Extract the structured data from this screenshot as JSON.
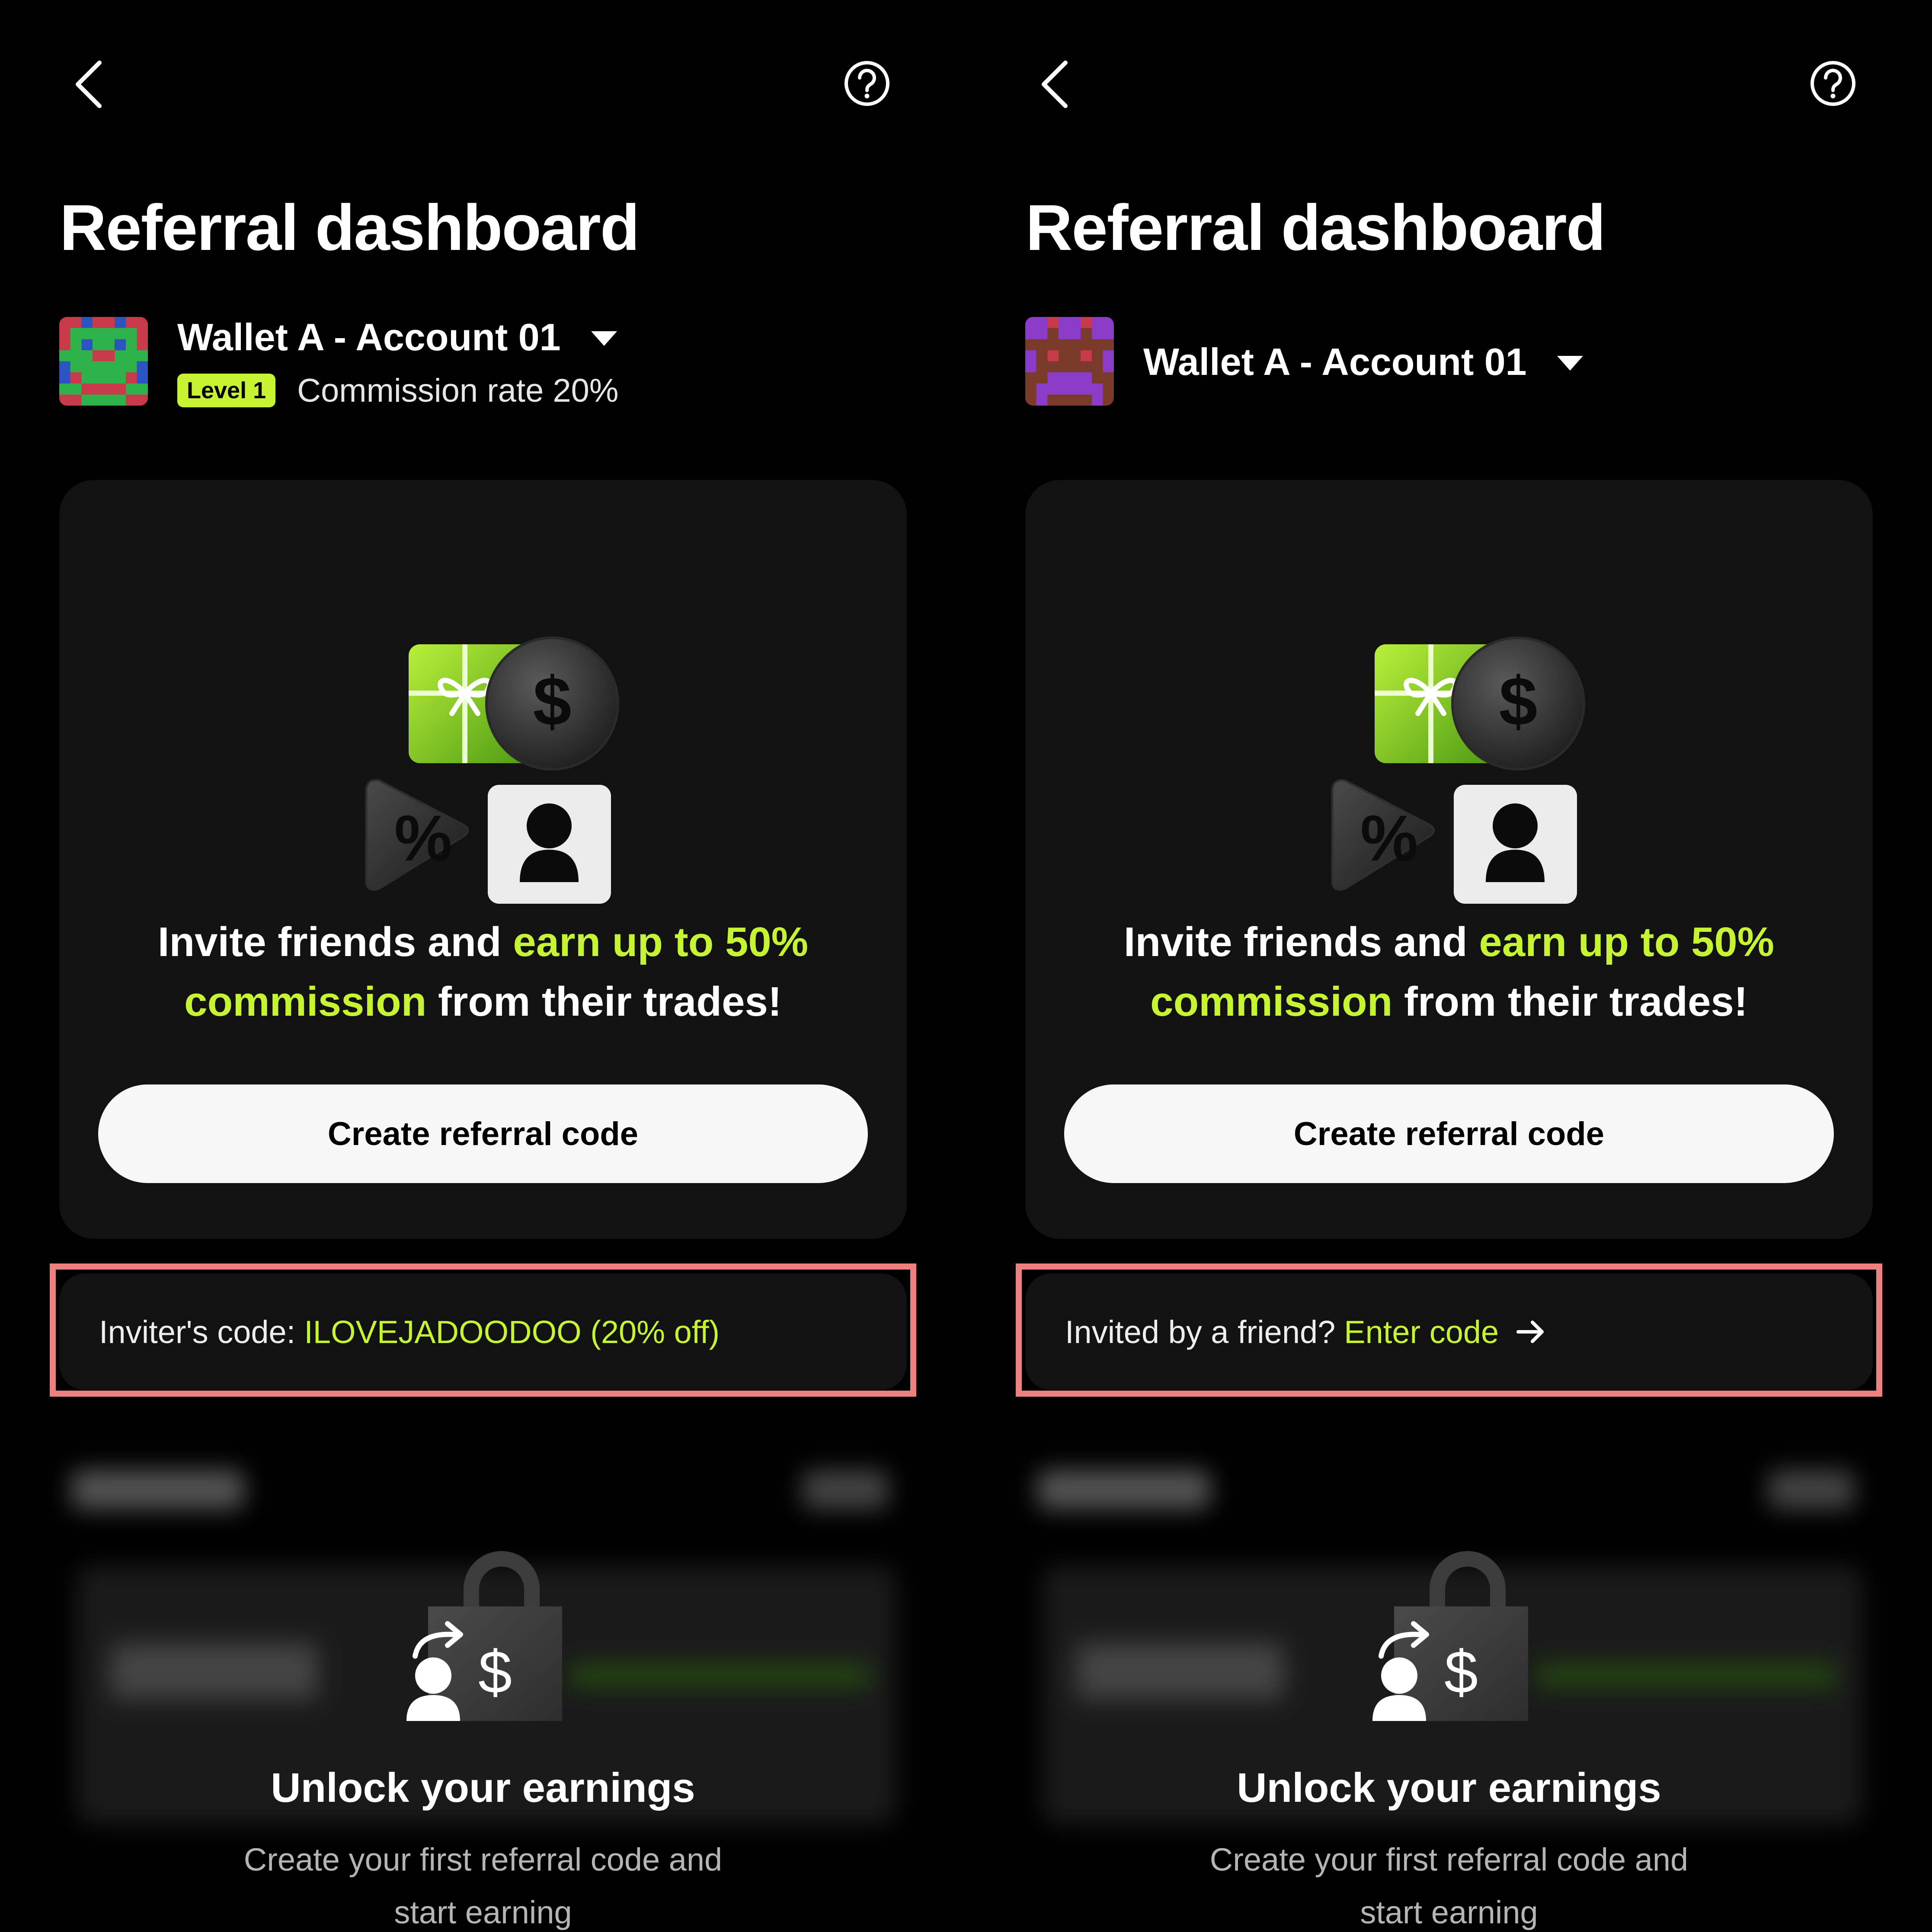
{
  "colors": {
    "accent": "#c6f432",
    "background": "#000000",
    "card": "#121212",
    "highlight_border": "#f08080",
    "button_bg": "#f7f7f7"
  },
  "screens": [
    {
      "header": {
        "back_icon": "chevron-left-icon",
        "help_icon": "question-circle-icon"
      },
      "title": "Referral dashboard",
      "account": {
        "name": "Wallet A - Account 01",
        "level": "Level 1",
        "commission": "Commission rate 20%"
      },
      "promo": {
        "part1": "Invite friends and ",
        "highlight": "earn up to 50% commission",
        "part2": " from their trades!"
      },
      "cta": "Create referral code",
      "code_bar": {
        "label": "Inviter's code:",
        "value": "ILOVEJADOODOO (20% off)"
      },
      "unlock": {
        "title": "Unlock your earnings",
        "line1": "Create your first referral code and",
        "line2": "start earning"
      }
    },
    {
      "header": {
        "back_icon": "chevron-left-icon",
        "help_icon": "question-circle-icon"
      },
      "title": "Referral dashboard",
      "account": {
        "name": "Wallet A - Account 01"
      },
      "promo": {
        "part1": "Invite friends and ",
        "highlight": "earn up to 50% commission",
        "part2": " from their trades!"
      },
      "cta": "Create referral code",
      "code_bar": {
        "label": "Invited by a friend?",
        "value": "Enter code"
      },
      "unlock": {
        "title": "Unlock your earnings",
        "line1": "Create your first referral code and",
        "line2": "start earning"
      }
    }
  ]
}
